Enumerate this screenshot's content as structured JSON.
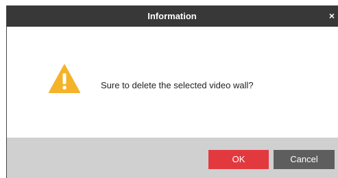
{
  "dialog": {
    "title": "Information",
    "close_label": "×",
    "message": "Sure to delete the selected video wall?",
    "icon": "warning-icon",
    "ok_label": "OK",
    "cancel_label": "Cancel"
  },
  "colors": {
    "titlebar": "#383838",
    "footer": "#d0d0d0",
    "ok": "#e2393f",
    "cancel": "#5e5e5e",
    "warning": "#f5b32a"
  }
}
